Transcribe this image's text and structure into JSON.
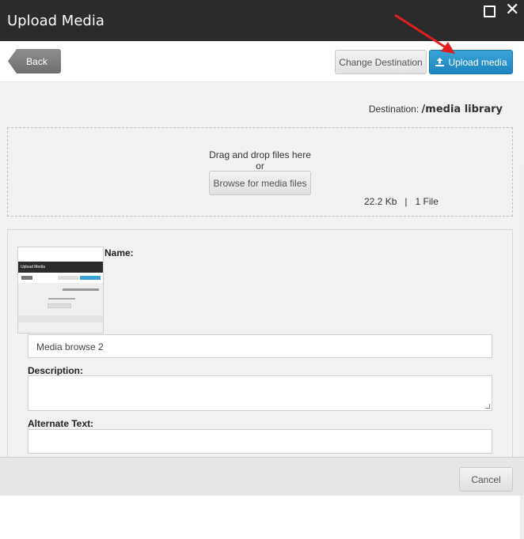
{
  "dialog": {
    "title": "Upload Media"
  },
  "toolbar": {
    "back_label": "Back",
    "change_destination_label": "Change Destination",
    "upload_label": "Upload media"
  },
  "destination": {
    "label": "Destination:",
    "value": "/media library"
  },
  "dropzone": {
    "drag_text": "Drag and drop files here",
    "or_text": "or",
    "browse_label": "Browse for media files",
    "size": "22.2 Kb",
    "separator": "|",
    "count": "1 File"
  },
  "file": {
    "name_label": "Name:",
    "name_value": "Media browse 2",
    "description_label": "Description:",
    "description_value": "",
    "alt_label": "Alternate Text:",
    "alt_value": ""
  },
  "thumbnail": {
    "title": "Upload Media"
  },
  "footer": {
    "cancel_label": "Cancel"
  },
  "colors": {
    "titlebar": "#2b2b2b",
    "accent": "#1c84c0",
    "annotation_arrow": "#e0201e"
  },
  "icons": [
    "maximize-icon",
    "close-icon",
    "upload-icon",
    "red-arrow-annotation"
  ]
}
